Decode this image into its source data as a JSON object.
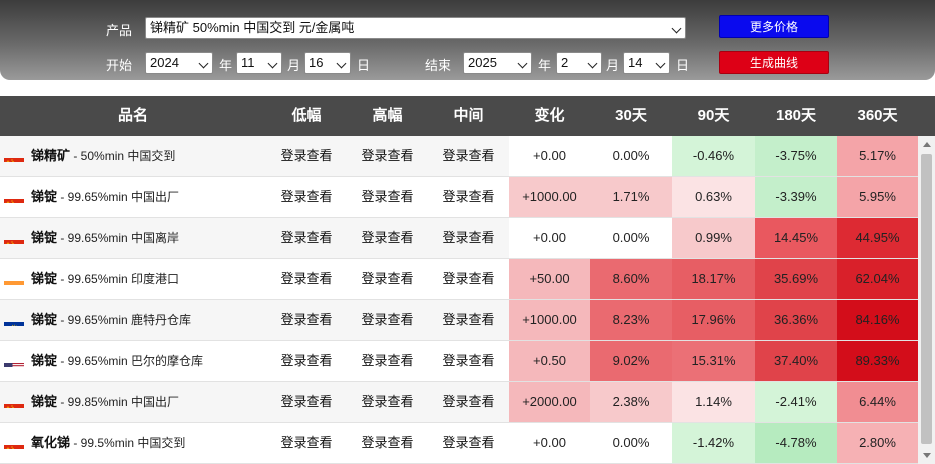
{
  "filter": {
    "product_label": "产品",
    "product_value": "锑精矿 50%min 中国交到 元/金属吨",
    "start_label": "开始",
    "start_year": "2024",
    "start_month": "11",
    "start_day": "16",
    "end_label": "结束",
    "end_year": "2025",
    "end_month": "2",
    "end_day": "14",
    "year_unit": "年",
    "month_unit": "月",
    "day_unit": "日",
    "more_prices_button": "更多价格",
    "generate_chart_button": "生成曲线"
  },
  "table": {
    "headers": [
      "品名",
      "低幅",
      "高幅",
      "中间",
      "变化",
      "30天",
      "90天",
      "180天",
      "360天"
    ],
    "login_text": "登录查看",
    "rows": [
      {
        "flag": "china-flag-icon",
        "name": "锑精矿",
        "desc": " - 50%min 中国交到",
        "change": "+0.00",
        "d30": "0.00%",
        "d90": "-0.46%",
        "d180": "-3.75%",
        "d360": "5.17%",
        "c_change": "#ffffff",
        "c30": "#ffffff",
        "c90": "#d4f4d8",
        "c180": "#c4efcb",
        "c360": "#f4a4a8"
      },
      {
        "flag": "china-flag-icon",
        "name": "锑锭",
        "desc": " - 99.65%min 中国出厂",
        "change": "+1000.00",
        "d30": "1.71%",
        "d90": "0.63%",
        "d180": "-3.39%",
        "d360": "5.95%",
        "c_change": "#f7c9cb",
        "c30": "#f7c9cb",
        "c90": "#fbe3e4",
        "c180": "#c4efcb",
        "c360": "#f4a4a8"
      },
      {
        "flag": "china-flag-icon",
        "name": "锑锭",
        "desc": " - 99.65%min 中国离岸",
        "change": "+0.00",
        "d30": "0.00%",
        "d90": "0.99%",
        "d180": "14.45%",
        "d360": "44.95%",
        "c_change": "#ffffff",
        "c30": "#ffffff",
        "c90": "#f7c9cb",
        "c180": "#e9585f",
        "c360": "#dd2a33"
      },
      {
        "flag": "india-flag-icon",
        "name": "锑锭",
        "desc": " - 99.65%min 印度港口",
        "change": "+50.00",
        "d30": "8.60%",
        "d90": "18.17%",
        "d180": "35.69%",
        "d360": "62.04%",
        "c_change": "#f5b8bb",
        "c30": "#ea6a70",
        "c90": "#e75e64",
        "c180": "#e0434a",
        "c360": "#d9202a"
      },
      {
        "flag": "eu-flag-icon",
        "name": "锑锭",
        "desc": " - 99.65%min 鹿特丹仓库",
        "change": "+1000.00",
        "d30": "8.23%",
        "d90": "17.96%",
        "d180": "36.36%",
        "d360": "84.16%",
        "c_change": "#f5b8bb",
        "c30": "#ea6a70",
        "c90": "#e75e64",
        "c180": "#e0434a",
        "c360": "#d30d1a"
      },
      {
        "flag": "us-flag-icon",
        "name": "锑锭",
        "desc": " - 99.65%min 巴尔的摩仓库",
        "change": "+0.50",
        "d30": "9.02%",
        "d90": "15.31%",
        "d180": "37.40%",
        "d360": "89.33%",
        "c_change": "#f5b8bb",
        "c30": "#ea6a70",
        "c90": "#eb7076",
        "c180": "#e0434a",
        "c360": "#d30d1a"
      },
      {
        "flag": "china-flag-icon",
        "name": "锑锭",
        "desc": " - 99.85%min 中国出厂",
        "change": "+2000.00",
        "d30": "2.38%",
        "d90": "1.14%",
        "d180": "-2.41%",
        "d360": "6.44%",
        "c_change": "#f5b8bb",
        "c30": "#f7c9cb",
        "c90": "#fbe3e4",
        "c180": "#d4f4d8",
        "c360": "#f18d92"
      },
      {
        "flag": "china-flag-icon",
        "name": "氧化锑",
        "desc": " - 99.5%min 中国交到",
        "change": "+0.00",
        "d30": "0.00%",
        "d90": "-1.42%",
        "d180": "-4.78%",
        "d360": "2.80%",
        "c_change": "#ffffff",
        "c30": "#ffffff",
        "c90": "#d4f4d8",
        "c180": "#b6ebbf",
        "c360": "#f6b1b4"
      }
    ]
  }
}
